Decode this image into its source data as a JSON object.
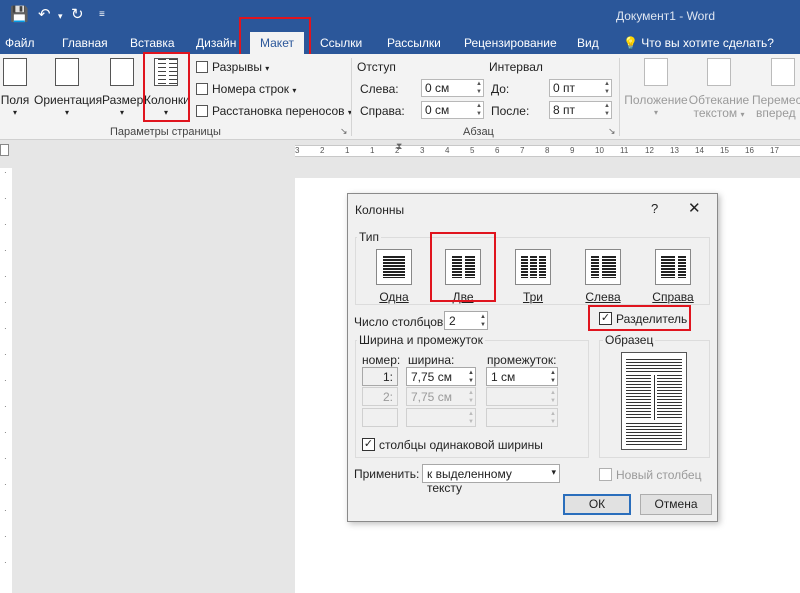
{
  "titlebar": {
    "doc_title": "Документ1 - Word"
  },
  "tabs": [
    {
      "label": "Файл"
    },
    {
      "label": "Главная"
    },
    {
      "label": "Вставка"
    },
    {
      "label": "Дизайн"
    },
    {
      "label": "Макет"
    },
    {
      "label": "Ссылки"
    },
    {
      "label": "Рассылки"
    },
    {
      "label": "Рецензирование"
    },
    {
      "label": "Вид"
    },
    {
      "label": "Что вы хотите сделать?"
    }
  ],
  "ribbon": {
    "fields": "Поля",
    "orientation": "Ориентация",
    "size": "Размер",
    "columns": "Колонки",
    "breaks": "Разрывы",
    "line_numbers": "Номера строк",
    "hyphenation": "Расстановка переносов",
    "page_setup_group": "Параметры страницы",
    "indent_label": "Отступ",
    "left_label": "Слева:",
    "right_label": "Справа:",
    "indent_left_value": "0 см",
    "indent_right_value": "0 см",
    "spacing_label": "Интервал",
    "before_label": "До:",
    "after_label": "После:",
    "spacing_before_value": "0 пт",
    "spacing_after_value": "8 пт",
    "paragraph_group": "Абзац",
    "position": "Положение",
    "wrap_line1": "Обтекание",
    "wrap_line2": "текстом",
    "forward_line1": "Перемест",
    "forward_line2": "вперед"
  },
  "ruler": {
    "numbers": [
      "3",
      "2",
      "1",
      "1",
      "2",
      "3",
      "4",
      "5",
      "6",
      "7",
      "8",
      "9",
      "10",
      "11",
      "12",
      "13",
      "14",
      "15",
      "16",
      "17"
    ]
  },
  "dialog": {
    "title": "Колонны",
    "help": "?",
    "close": "✕",
    "type_legend": "Тип",
    "presets": [
      {
        "label": "Одна"
      },
      {
        "label": "Две"
      },
      {
        "label": "Три"
      },
      {
        "label": "Слева"
      },
      {
        "label": "Справа"
      }
    ],
    "num_columns_label": "Число столбцов:",
    "num_columns_value": "2",
    "separator_label": "Разделитель",
    "width_spacing_legend": "Ширина и промежуток",
    "col_number_header": "номер:",
    "col_width_header": "ширина:",
    "col_spacing_header": "промежуток:",
    "rows": [
      {
        "num": "1:",
        "width": "7,75 см",
        "spacing": "1 см"
      },
      {
        "num": "2:",
        "width": "7,75 см",
        "spacing": ""
      },
      {
        "num": "",
        "width": "",
        "spacing": ""
      }
    ],
    "equal_width_label": "столбцы одинаковой ширины",
    "preview_legend": "Образец",
    "apply_label": "Применить:",
    "apply_value": "к выделенному тексту",
    "new_column_label": "Новый столбец",
    "ok": "ОК",
    "cancel": "Отмена"
  }
}
